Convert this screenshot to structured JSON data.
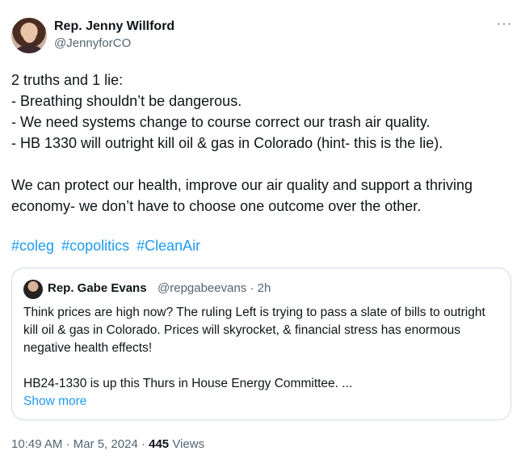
{
  "author": {
    "display_name": "Rep. Jenny Willford",
    "handle": "@JennyforCO"
  },
  "tweet": {
    "text": "2 truths and 1 lie:\n- Breathing shouldn’t be dangerous.\n- We need systems change to course correct our trash air quality.\n- HB 1330 will outright kill oil & gas in Colorado (hint- this is the lie).\n\nWe can protect our health, improve our air quality and support a thriving economy- we don’t have to choose one outcome over the other.",
    "hashtags": [
      "#coleg",
      "#copolitics",
      "#CleanAir"
    ]
  },
  "quoted": {
    "display_name": "Rep. Gabe Evans",
    "handle": "@repgabeevans",
    "separator": "·",
    "age": "2h",
    "text": "Think prices are high now? The ruling Left is trying to pass a slate of bills to outright kill oil & gas in Colorado. Prices will skyrocket, & financial stress has enormous negative health effects!\n\nHB24-1330 is up this Thurs in House Energy Committee. ...",
    "show_more": "Show more"
  },
  "footer": {
    "time": "10:49 AM",
    "date": "Mar 5, 2024",
    "separator": "·",
    "views_count": "445",
    "views_label": "Views"
  },
  "menu": {
    "more_icon": "···"
  }
}
